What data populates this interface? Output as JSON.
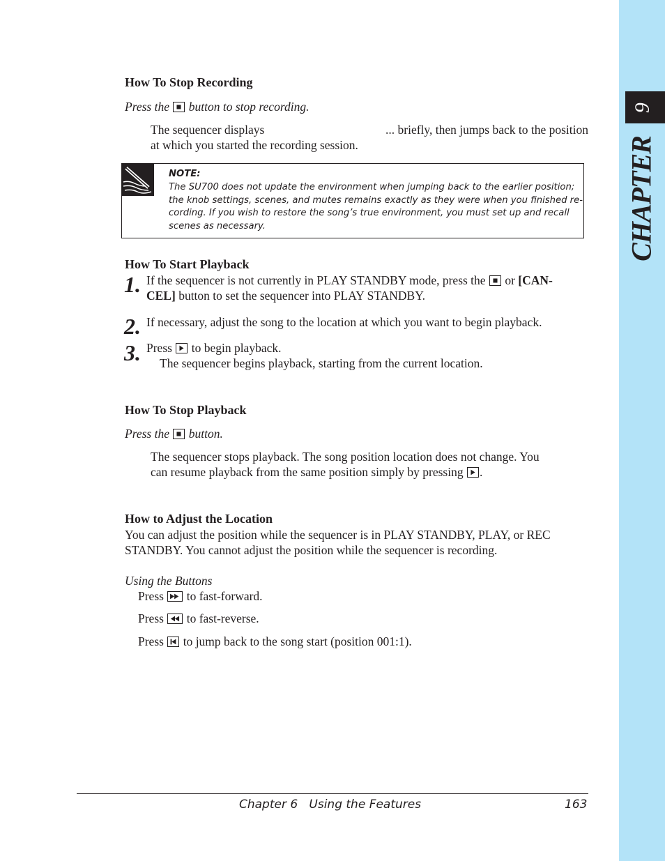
{
  "sidebar": {
    "chapter_number": "6",
    "chapter_word": "CHAPTER",
    "accent_color": "#b3e3f8"
  },
  "sections": {
    "stop_recording": {
      "heading": "How To Stop Recording",
      "instruction_pre": "Press the",
      "instruction_icon": "stop-button",
      "instruction_post": "button to stop recording.",
      "body_line1_pre": "The sequencer displays",
      "body_line1_post": "... briefly, then jumps back to the position",
      "body_line2": "at which you started the recording session."
    },
    "note": {
      "label": "NOTE:",
      "lines": [
        "The SU700 does not update the environment when jumping back to the earlier position;",
        "the knob settings, scenes, and mutes remains exactly as they were when you finished re-",
        "cording. If you wish to restore the song’s true environment, you must set up and recall",
        "scenes as necessary."
      ]
    },
    "start_playback": {
      "heading": "How To Start Playback",
      "steps": [
        {
          "number": "1.",
          "line1_pre": "If the sequencer is not currently in PLAY STANDBY mode, press the",
          "line1_mid": "or",
          "line1_bold": "[CAN-",
          "line2_bold": "CEL]",
          "line2": "button to set the sequencer into PLAY STANDBY."
        },
        {
          "number": "2.",
          "text": "If necessary, adjust the song to the location at which you want to begin playback."
        },
        {
          "number": "3.",
          "line1_pre": "Press",
          "line1_post": "to begin playback.",
          "line2": "The sequencer begins playback, starting from the current location."
        }
      ]
    },
    "stop_playback": {
      "heading": "How To Stop Playback",
      "instruction_pre": "Press the",
      "instruction_post": "button.",
      "body_line1": "The sequencer stops playback. The song position location does not change. You",
      "body_line2_pre": "can resume playback from the same position simply by pressing",
      "body_line2_post": "."
    },
    "adjust_location": {
      "heading": "How to Adjust the Location",
      "body_line1": "You can adjust the position while the sequencer is in PLAY STANDBY, PLAY, or REC",
      "body_line2": "STANDBY. You cannot adjust the position while the sequencer is recording.",
      "subheading": "Using the Buttons",
      "items": [
        {
          "pre": "Press",
          "icon": "fast-forward-button",
          "post": "to fast-forward."
        },
        {
          "pre": "Press",
          "icon": "fast-reverse-button",
          "post": "to fast-reverse."
        },
        {
          "pre": "Press",
          "icon": "song-start-button",
          "post": "to jump back to the song start (position 001:1)."
        }
      ]
    }
  },
  "footer": {
    "chapter_title": "Chapter 6   Using the Features",
    "page_number": "163"
  }
}
